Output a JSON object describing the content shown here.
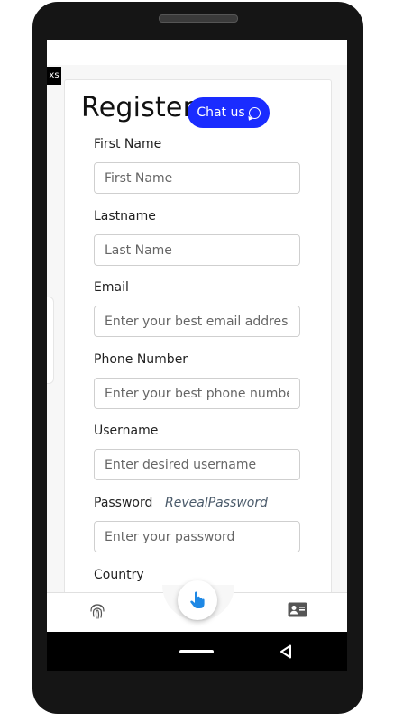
{
  "badge": "xs",
  "form": {
    "title": "Register",
    "chat_button": "Chat us",
    "fields": [
      {
        "label": "First Name",
        "placeholder": "First Name"
      },
      {
        "label": "Lastname",
        "placeholder": "Last Name"
      },
      {
        "label": "Email",
        "placeholder": "Enter your best email address"
      },
      {
        "label": "Phone Number",
        "placeholder": "Enter your best phone number"
      },
      {
        "label": "Username",
        "placeholder": "Enter desired username"
      },
      {
        "label": "Password",
        "placeholder": "Enter your password"
      }
    ],
    "reveal_password": "RevealPassword",
    "country_label": "Country"
  },
  "colors": {
    "accent": "#1a2cff"
  },
  "icons": {
    "chat": "whatsapp-icon",
    "nav_left": "fingerprint-icon",
    "nav_center": "tap-hand-icon",
    "nav_right": "contact-card-icon",
    "sys_back": "back-triangle-icon"
  }
}
